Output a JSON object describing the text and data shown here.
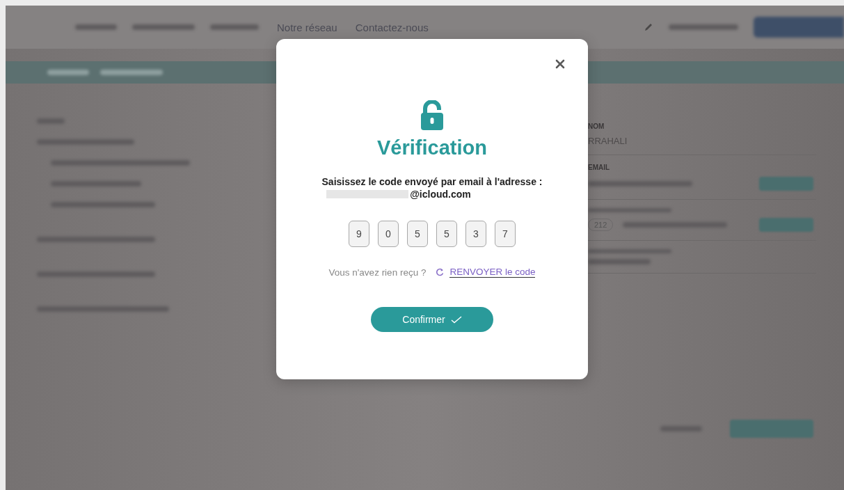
{
  "header": {
    "nav": [
      {
        "label": "Notre réseau"
      },
      {
        "label": "Contactez-nous"
      }
    ]
  },
  "profile_form": {
    "fields": [
      {
        "label": "NOM",
        "value": "RRAHALI"
      },
      {
        "label": "EMAIL"
      },
      {
        "prefix": "212"
      }
    ]
  },
  "modal": {
    "title": "Vérification",
    "message": "Saisissez le code envoyé par email à l'adresse :",
    "email_visible": "@icloud.com",
    "code": [
      "9",
      "0",
      "5",
      "5",
      "3",
      "7"
    ],
    "resend_prompt": "Vous n'avez rien reçu ?",
    "resend_link": "RENVOYER le code",
    "confirm_button": "Confirmer"
  }
}
